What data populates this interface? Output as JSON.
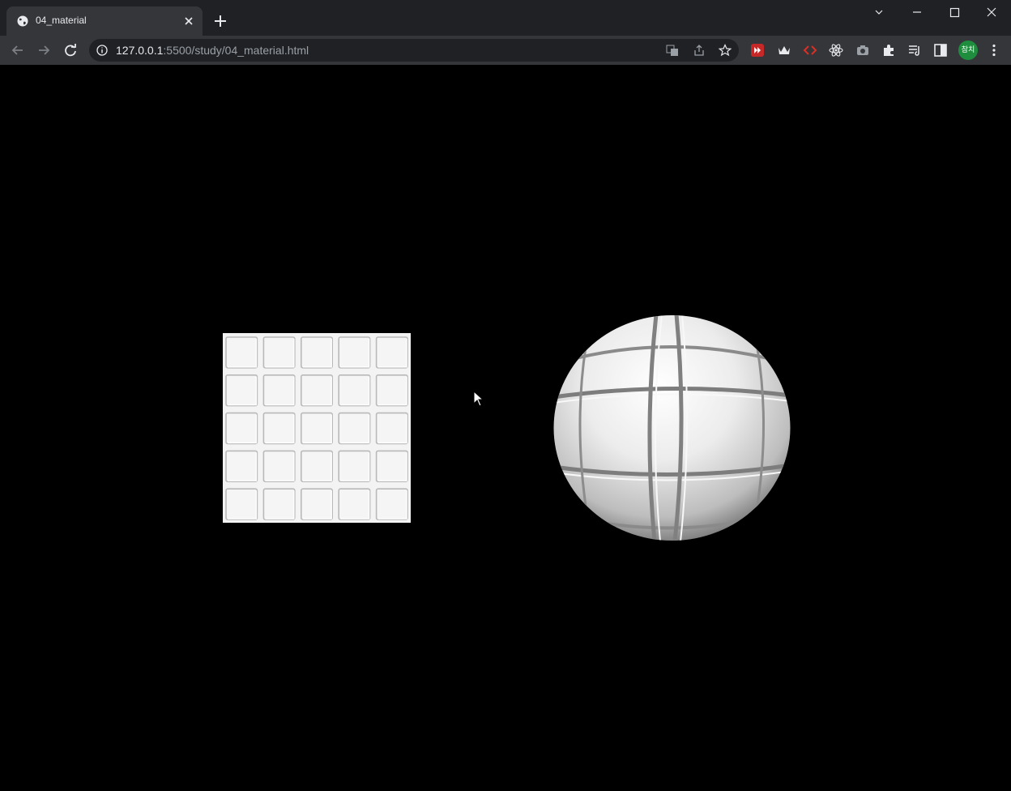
{
  "browser": {
    "tab": {
      "title": "04_material",
      "icon": "globe-icon"
    },
    "address": {
      "host": "127.0.0.1",
      "path": ":5500/study/04_material.html"
    },
    "profile_avatar": "참치",
    "extensions": [
      "translate-icon",
      "share-icon",
      "star-icon",
      "extension-red-icon",
      "crown-icon",
      "code-icon",
      "react-icon",
      "camera-icon",
      "puzzle-icon",
      "reading-list-icon",
      "side-panel-icon",
      "menu-icon"
    ]
  },
  "scene": {
    "background": "#000000",
    "plane": {
      "material": "tiled normal map",
      "grid": [
        5,
        5
      ],
      "color": "#f2f2f2"
    },
    "sphere": {
      "material": "tiled normal map",
      "color": "#e6e6e6"
    }
  },
  "colors": {
    "tabstrip": "#202124",
    "toolbar": "#35363a",
    "omnibox": "#202124",
    "accent": "#1e8e3e"
  }
}
